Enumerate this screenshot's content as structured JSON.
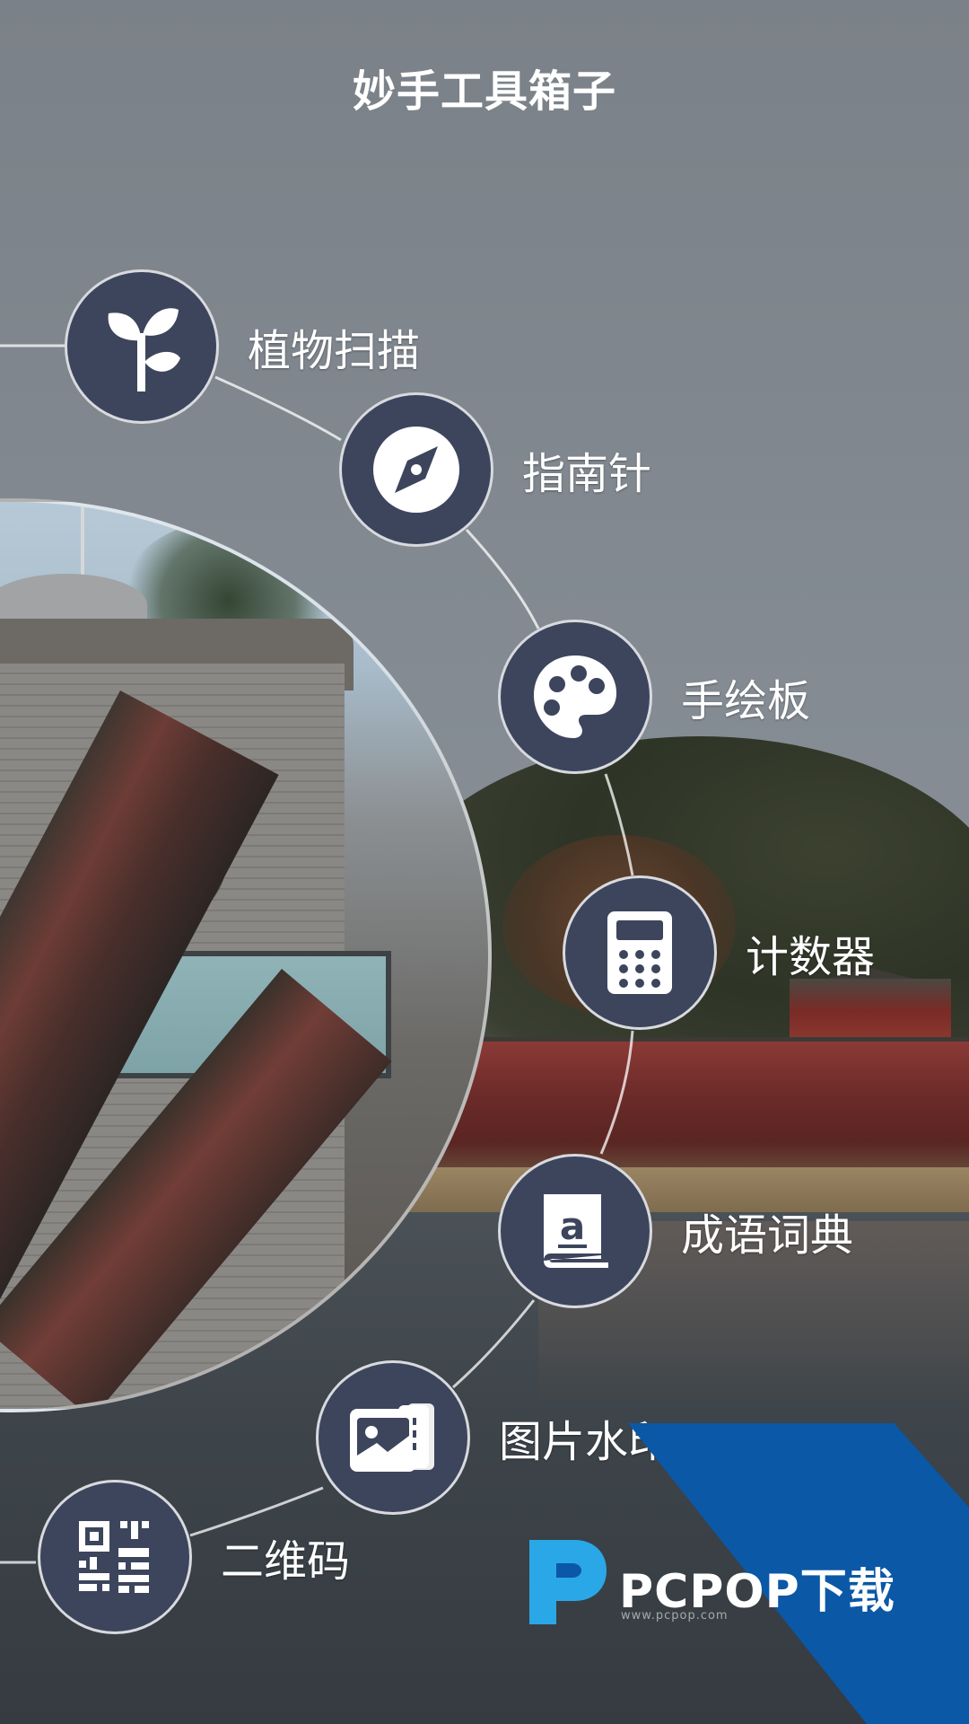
{
  "app": {
    "title": "妙手工具箱子"
  },
  "tools": [
    {
      "id": "plant-scan",
      "label": "植物扫描",
      "icon": "sprout-icon"
    },
    {
      "id": "compass",
      "label": "指南针",
      "icon": "compass-icon"
    },
    {
      "id": "drawing-board",
      "label": "手绘板",
      "icon": "palette-icon"
    },
    {
      "id": "counter",
      "label": "计数器",
      "icon": "calculator-icon"
    },
    {
      "id": "idiom-dictionary",
      "label": "成语词典",
      "icon": "dictionary-icon"
    },
    {
      "id": "image-watermark",
      "label": "图片水印",
      "icon": "image-stack-icon"
    },
    {
      "id": "qr-code",
      "label": "二维码",
      "icon": "qr-code-icon"
    }
  ],
  "watermark": {
    "brand": "PCPOP下载",
    "tagline": "www.pcpop.com"
  },
  "colors": {
    "node_fill": "#3d455d",
    "watermark_blue": "#0b58a6",
    "logo_cyan": "#2aa7e6"
  }
}
